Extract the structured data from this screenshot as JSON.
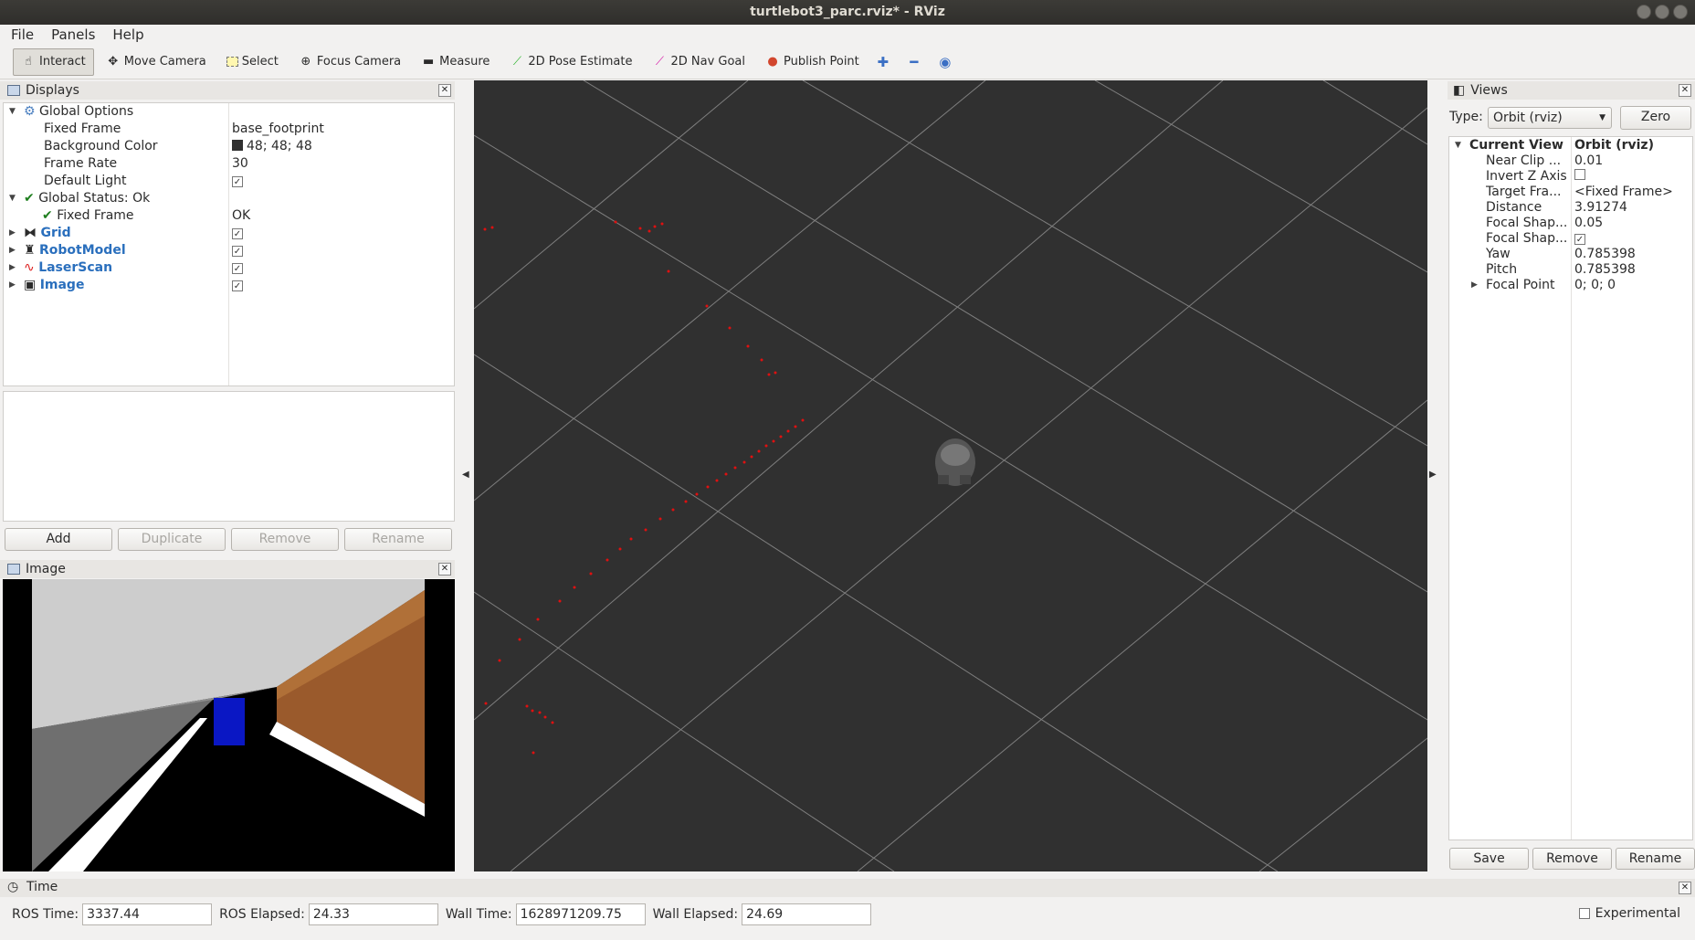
{
  "window": {
    "title": "turtlebot3_parc.rviz* - RViz"
  },
  "menu": [
    "File",
    "Panels",
    "Help"
  ],
  "toolbar": {
    "interact": "Interact",
    "move_camera": "Move Camera",
    "select": "Select",
    "focus_camera": "Focus Camera",
    "measure": "Measure",
    "pose_estimate": "2D Pose Estimate",
    "nav_goal": "2D Nav Goal",
    "publish_point": "Publish Point"
  },
  "displays": {
    "title": "Displays",
    "global_options": "Global Options",
    "fixed_frame_label": "Fixed Frame",
    "fixed_frame_value": "base_footprint",
    "background_color_label": "Background Color",
    "background_color_value": "48; 48; 48",
    "frame_rate_label": "Frame Rate",
    "frame_rate_value": "30",
    "default_light_label": "Default Light",
    "global_status": "Global Status: Ok",
    "status_fixed_frame": "Fixed Frame",
    "status_fixed_frame_value": "OK",
    "items": [
      "Grid",
      "RobotModel",
      "LaserScan",
      "Image"
    ],
    "buttons": {
      "add": "Add",
      "duplicate": "Duplicate",
      "remove": "Remove",
      "rename": "Rename"
    }
  },
  "image_panel": {
    "title": "Image"
  },
  "views": {
    "title": "Views",
    "type_label": "Type:",
    "type_value": "Orbit (rviz)",
    "zero": "Zero",
    "current_view": "Current View",
    "current_view_value": "Orbit (rviz)",
    "rows": [
      {
        "k": "Near Clip ...",
        "v": "0.01"
      },
      {
        "k": "Invert Z Axis",
        "v": ""
      },
      {
        "k": "Target Fra...",
        "v": "<Fixed Frame>"
      },
      {
        "k": "Distance",
        "v": "3.91274"
      },
      {
        "k": "Focal Shap...",
        "v": "0.05"
      },
      {
        "k": "Focal Shap...",
        "v": ""
      },
      {
        "k": "Yaw",
        "v": "0.785398"
      },
      {
        "k": "Pitch",
        "v": "0.785398"
      },
      {
        "k": "Focal Point",
        "v": "0; 0; 0"
      }
    ],
    "buttons": {
      "save": "Save",
      "remove": "Remove",
      "rename": "Rename"
    }
  },
  "time": {
    "title": "Time",
    "ros_time_label": "ROS Time:",
    "ros_time": "3337.44",
    "ros_elapsed_label": "ROS Elapsed:",
    "ros_elapsed": "24.33",
    "wall_time_label": "Wall Time:",
    "wall_time": "1628971209.75",
    "wall_elapsed_label": "Wall Elapsed:",
    "wall_elapsed": "24.69",
    "experimental": "Experimental"
  }
}
